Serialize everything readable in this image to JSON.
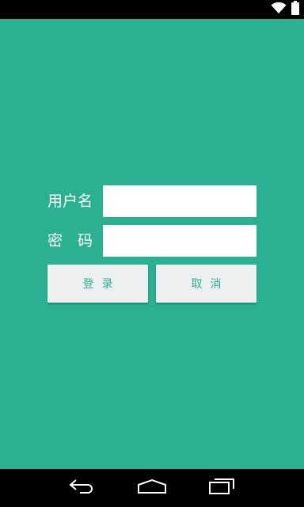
{
  "status_bar": {
    "wifi_icon": "wifi-icon",
    "battery_icon": "battery-icon"
  },
  "login_form": {
    "username_label": "用户名",
    "password_label": "密　码",
    "username_value": "",
    "password_value": "",
    "login_button": "登录",
    "cancel_button": "取消"
  },
  "nav_bar": {
    "back_icon": "back-icon",
    "home_icon": "home-icon",
    "recents_icon": "recents-icon"
  },
  "colors": {
    "background": "#2bb092",
    "button_bg": "#eeeff1",
    "button_text": "#2bb092"
  }
}
